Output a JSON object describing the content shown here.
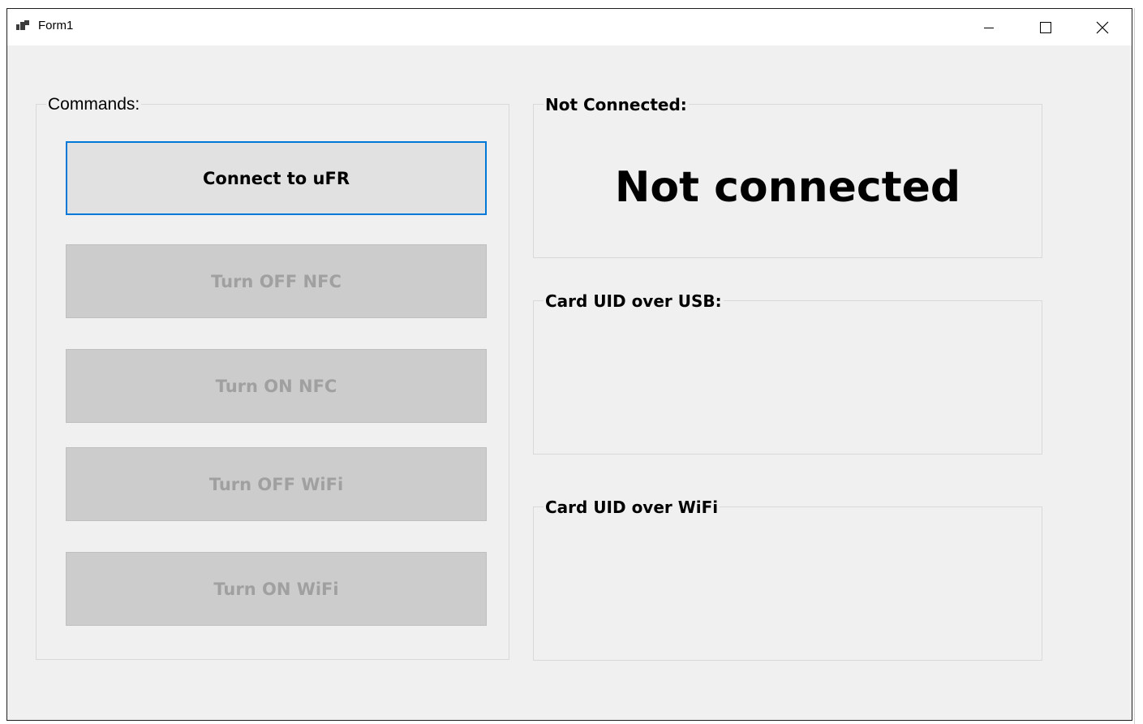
{
  "window": {
    "title": "Form1"
  },
  "commands_group": {
    "label": "Commands:",
    "buttons": [
      {
        "label": "Connect to uFR",
        "enabled": true
      },
      {
        "label": "Turn OFF NFC",
        "enabled": false
      },
      {
        "label": "Turn ON NFC",
        "enabled": false
      },
      {
        "label": "Turn OFF WiFi",
        "enabled": false
      },
      {
        "label": "Turn ON WiFi",
        "enabled": false
      }
    ]
  },
  "status_group": {
    "label": "Not Connected:",
    "status": "Not connected"
  },
  "usb_group": {
    "label": "Card UID over USB:",
    "value": ""
  },
  "wifi_group": {
    "label": "Card UID over WiFi",
    "value": ""
  },
  "colors": {
    "focus_border": "#0078d7",
    "disabled_text": "#a0a0a0",
    "form_background": "#f0f0f0"
  }
}
